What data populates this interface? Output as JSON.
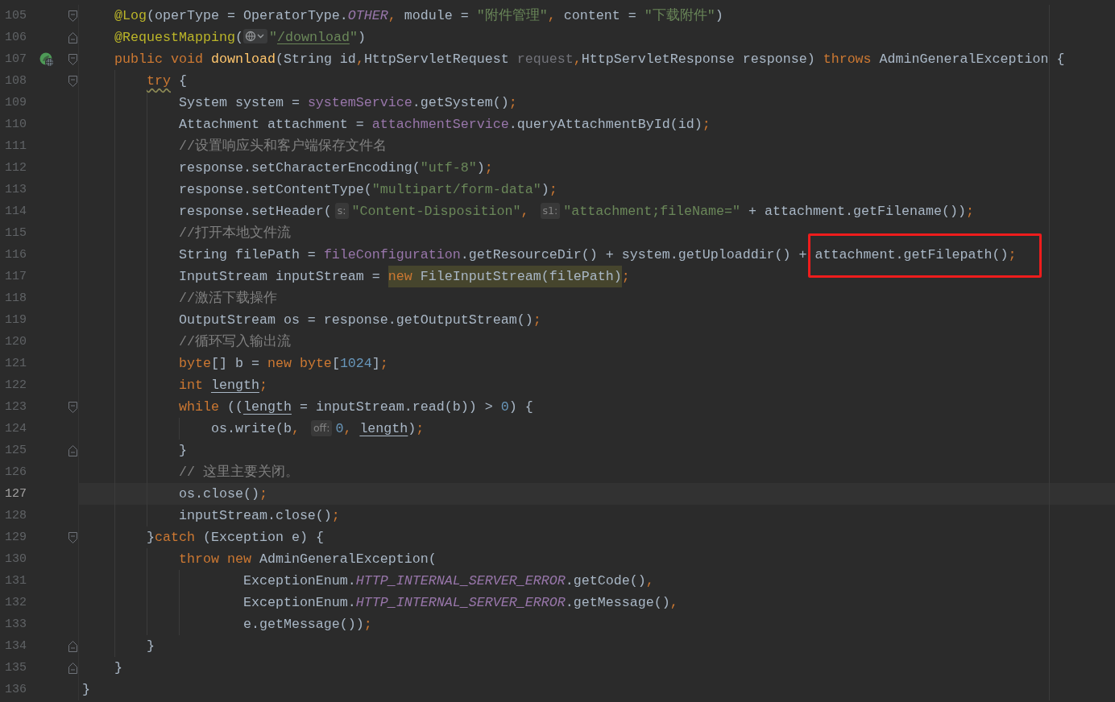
{
  "editor": {
    "lines": [
      {
        "number": "105",
        "fold_start": true,
        "fold_end": false,
        "endpoint": false,
        "current": false,
        "tokens": [
          {
            "kind": "annotation",
            "text": "    @Log"
          },
          {
            "kind": "plain",
            "text": "(operType = OperatorType."
          },
          {
            "kind": "constant",
            "text": "OTHER"
          },
          {
            "kind": "punct",
            "text": ","
          },
          {
            "kind": "plain",
            "text": " module = "
          },
          {
            "kind": "string",
            "text": "\"附件管理\""
          },
          {
            "kind": "punct",
            "text": ","
          },
          {
            "kind": "plain",
            "text": " content = "
          },
          {
            "kind": "string",
            "text": "\"下载附件\""
          },
          {
            "kind": "plain",
            "text": ")"
          }
        ]
      },
      {
        "number": "106",
        "fold_start": false,
        "fold_end": true,
        "endpoint": false,
        "current": false,
        "tokens": [
          {
            "kind": "annotation",
            "text": "    @RequestMapping"
          },
          {
            "kind": "plain",
            "text": "("
          },
          {
            "kind": "url-icon"
          },
          {
            "kind": "string",
            "text": "\""
          },
          {
            "kind": "link",
            "text": "/download"
          },
          {
            "kind": "string",
            "text": "\""
          },
          {
            "kind": "plain",
            "text": ")"
          }
        ]
      },
      {
        "number": "107",
        "fold_start": true,
        "fold_end": false,
        "endpoint": true,
        "current": false,
        "tokens": [
          {
            "kind": "keyword",
            "text": "    public void "
          },
          {
            "kind": "method",
            "text": "download"
          },
          {
            "kind": "plain",
            "text": "(String id"
          },
          {
            "kind": "punct",
            "text": ","
          },
          {
            "kind": "plain",
            "text": "HttpServletRequest "
          },
          {
            "kind": "unused",
            "text": "request"
          },
          {
            "kind": "punct",
            "text": ","
          },
          {
            "kind": "plain",
            "text": "HttpServletResponse response) "
          },
          {
            "kind": "keyword",
            "text": "throws "
          },
          {
            "kind": "plain",
            "text": "AdminGeneralException {"
          }
        ]
      },
      {
        "number": "108",
        "fold_start": true,
        "fold_end": false,
        "endpoint": false,
        "current": false,
        "tokens": [
          {
            "kind": "keyword-warning",
            "text": "        try"
          },
          {
            "kind": "plain",
            "text": " {"
          }
        ]
      },
      {
        "number": "109",
        "fold_start": false,
        "fold_end": false,
        "endpoint": false,
        "current": false,
        "tokens": [
          {
            "kind": "plain",
            "text": "            System system = "
          },
          {
            "kind": "field",
            "text": "systemService"
          },
          {
            "kind": "plain",
            "text": ".getSystem()"
          },
          {
            "kind": "punct",
            "text": ";"
          }
        ]
      },
      {
        "number": "110",
        "fold_start": false,
        "fold_end": false,
        "endpoint": false,
        "current": false,
        "tokens": [
          {
            "kind": "plain",
            "text": "            Attachment attachment = "
          },
          {
            "kind": "field",
            "text": "attachmentService"
          },
          {
            "kind": "plain",
            "text": ".queryAttachmentById(id)"
          },
          {
            "kind": "punct",
            "text": ";"
          }
        ]
      },
      {
        "number": "111",
        "fold_start": false,
        "fold_end": false,
        "endpoint": false,
        "current": false,
        "tokens": [
          {
            "kind": "comment",
            "text": "            //设置响应头和客户端保存文件名"
          }
        ]
      },
      {
        "number": "112",
        "fold_start": false,
        "fold_end": false,
        "endpoint": false,
        "current": false,
        "tokens": [
          {
            "kind": "plain",
            "text": "            response.setCharacterEncoding("
          },
          {
            "kind": "string",
            "text": "\"utf-8\""
          },
          {
            "kind": "plain",
            "text": ")"
          },
          {
            "kind": "punct",
            "text": ";"
          }
        ]
      },
      {
        "number": "113",
        "fold_start": false,
        "fold_end": false,
        "endpoint": false,
        "current": false,
        "tokens": [
          {
            "kind": "plain",
            "text": "            response.setContentType("
          },
          {
            "kind": "string",
            "text": "\"multipart/form-data\""
          },
          {
            "kind": "plain",
            "text": ")"
          },
          {
            "kind": "punct",
            "text": ";"
          }
        ]
      },
      {
        "number": "114",
        "fold_start": false,
        "fold_end": false,
        "endpoint": false,
        "current": false,
        "tokens": [
          {
            "kind": "plain",
            "text": "            response.setHeader("
          },
          {
            "kind": "hint",
            "text": "s:"
          },
          {
            "kind": "string",
            "text": "\"Content-Disposition\""
          },
          {
            "kind": "punct",
            "text": ", "
          },
          {
            "kind": "hint",
            "text": "s1:"
          },
          {
            "kind": "string",
            "text": "\"attachment;fileName=\""
          },
          {
            "kind": "plain",
            "text": " + attachment.getFilename())"
          },
          {
            "kind": "punct",
            "text": ";"
          }
        ]
      },
      {
        "number": "115",
        "fold_start": false,
        "fold_end": false,
        "endpoint": false,
        "current": false,
        "tokens": [
          {
            "kind": "comment",
            "text": "            //打开本地文件流"
          }
        ]
      },
      {
        "number": "116",
        "fold_start": false,
        "fold_end": false,
        "endpoint": false,
        "current": false,
        "tokens": [
          {
            "kind": "plain",
            "text": "            String filePath = "
          },
          {
            "kind": "field",
            "text": "fileConfiguration"
          },
          {
            "kind": "plain",
            "text": ".getResourceDir() + system.getUploaddir() + "
          },
          {
            "kind": "red-box",
            "tokens": [
              {
                "kind": "plain",
                "text": "attachment.getFilepath()"
              },
              {
                "kind": "punct",
                "text": ";"
              }
            ]
          }
        ]
      },
      {
        "number": "117",
        "fold_start": false,
        "fold_end": false,
        "endpoint": false,
        "current": false,
        "tokens": [
          {
            "kind": "plain",
            "text": "            InputStream inputStream = "
          },
          {
            "kind": "highlight",
            "tokens": [
              {
                "kind": "keyword",
                "text": "new "
              },
              {
                "kind": "plain",
                "text": "FileInputStream(filePath)"
              }
            ]
          },
          {
            "kind": "punct",
            "text": ";"
          }
        ]
      },
      {
        "number": "118",
        "fold_start": false,
        "fold_end": false,
        "endpoint": false,
        "current": false,
        "tokens": [
          {
            "kind": "comment",
            "text": "            //激活下载操作"
          }
        ]
      },
      {
        "number": "119",
        "fold_start": false,
        "fold_end": false,
        "endpoint": false,
        "current": false,
        "tokens": [
          {
            "kind": "plain",
            "text": "            OutputStream os = response.getOutputStream()"
          },
          {
            "kind": "punct",
            "text": ";"
          }
        ]
      },
      {
        "number": "120",
        "fold_start": false,
        "fold_end": false,
        "endpoint": false,
        "current": false,
        "tokens": [
          {
            "kind": "comment",
            "text": "            //循环写入输出流"
          }
        ]
      },
      {
        "number": "121",
        "fold_start": false,
        "fold_end": false,
        "endpoint": false,
        "current": false,
        "tokens": [
          {
            "kind": "keyword",
            "text": "            byte"
          },
          {
            "kind": "plain",
            "text": "[] b = "
          },
          {
            "kind": "keyword",
            "text": "new byte"
          },
          {
            "kind": "plain",
            "text": "["
          },
          {
            "kind": "number",
            "text": "1024"
          },
          {
            "kind": "plain",
            "text": "]"
          },
          {
            "kind": "punct",
            "text": ";"
          }
        ]
      },
      {
        "number": "122",
        "fold_start": false,
        "fold_end": false,
        "endpoint": false,
        "current": false,
        "tokens": [
          {
            "kind": "keyword",
            "text": "            int "
          },
          {
            "kind": "reassigned",
            "text": "length"
          },
          {
            "kind": "punct",
            "text": ";"
          }
        ]
      },
      {
        "number": "123",
        "fold_start": true,
        "fold_end": false,
        "endpoint": false,
        "current": false,
        "tokens": [
          {
            "kind": "keyword",
            "text": "            while "
          },
          {
            "kind": "plain",
            "text": "(("
          },
          {
            "kind": "reassigned",
            "text": "length"
          },
          {
            "kind": "plain",
            "text": " = inputStream.read(b)) > "
          },
          {
            "kind": "number",
            "text": "0"
          },
          {
            "kind": "plain",
            "text": ") {"
          }
        ]
      },
      {
        "number": "124",
        "fold_start": false,
        "fold_end": false,
        "endpoint": false,
        "current": false,
        "tokens": [
          {
            "kind": "plain",
            "text": "                os.write(b"
          },
          {
            "kind": "punct",
            "text": ", "
          },
          {
            "kind": "hint",
            "text": "off:"
          },
          {
            "kind": "number",
            "text": "0"
          },
          {
            "kind": "punct",
            "text": ", "
          },
          {
            "kind": "reassigned",
            "text": "length"
          },
          {
            "kind": "plain",
            "text": ")"
          },
          {
            "kind": "punct",
            "text": ";"
          }
        ]
      },
      {
        "number": "125",
        "fold_start": false,
        "fold_end": true,
        "endpoint": false,
        "current": false,
        "tokens": [
          {
            "kind": "plain",
            "text": "            }"
          }
        ]
      },
      {
        "number": "126",
        "fold_start": false,
        "fold_end": false,
        "endpoint": false,
        "current": false,
        "tokens": [
          {
            "kind": "comment",
            "text": "            // 这里主要关闭。"
          }
        ]
      },
      {
        "number": "127",
        "fold_start": false,
        "fold_end": false,
        "endpoint": false,
        "current": true,
        "tokens": [
          {
            "kind": "plain",
            "text": "            os.close()"
          },
          {
            "kind": "punct",
            "text": ";"
          }
        ]
      },
      {
        "number": "128",
        "fold_start": false,
        "fold_end": false,
        "endpoint": false,
        "current": false,
        "tokens": [
          {
            "kind": "plain",
            "text": "            inputStream.close()"
          },
          {
            "kind": "punct",
            "text": ";"
          }
        ]
      },
      {
        "number": "129",
        "fold_start": true,
        "fold_end": false,
        "endpoint": false,
        "current": false,
        "tokens": [
          {
            "kind": "plain",
            "text": "        }"
          },
          {
            "kind": "keyword",
            "text": "catch "
          },
          {
            "kind": "plain",
            "text": "(Exception e) {"
          }
        ]
      },
      {
        "number": "130",
        "fold_start": false,
        "fold_end": false,
        "endpoint": false,
        "current": false,
        "tokens": [
          {
            "kind": "keyword",
            "text": "            throw new "
          },
          {
            "kind": "plain",
            "text": "AdminGeneralException("
          }
        ]
      },
      {
        "number": "131",
        "fold_start": false,
        "fold_end": false,
        "endpoint": false,
        "current": false,
        "tokens": [
          {
            "kind": "plain",
            "text": "                    ExceptionEnum."
          },
          {
            "kind": "constant",
            "text": "HTTP_INTERNAL_SERVER_ERROR"
          },
          {
            "kind": "plain",
            "text": ".getCode()"
          },
          {
            "kind": "punct",
            "text": ","
          }
        ]
      },
      {
        "number": "132",
        "fold_start": false,
        "fold_end": false,
        "endpoint": false,
        "current": false,
        "tokens": [
          {
            "kind": "plain",
            "text": "                    ExceptionEnum."
          },
          {
            "kind": "constant",
            "text": "HTTP_INTERNAL_SERVER_ERROR"
          },
          {
            "kind": "plain",
            "text": ".getMessage()"
          },
          {
            "kind": "punct",
            "text": ","
          }
        ]
      },
      {
        "number": "133",
        "fold_start": false,
        "fold_end": false,
        "endpoint": false,
        "current": false,
        "tokens": [
          {
            "kind": "plain",
            "text": "                    e.getMessage())"
          },
          {
            "kind": "punct",
            "text": ";"
          }
        ]
      },
      {
        "number": "134",
        "fold_start": false,
        "fold_end": true,
        "endpoint": false,
        "current": false,
        "tokens": [
          {
            "kind": "plain",
            "text": "        }"
          }
        ]
      },
      {
        "number": "135",
        "fold_start": false,
        "fold_end": true,
        "endpoint": false,
        "current": false,
        "tokens": [
          {
            "kind": "plain",
            "text": "    }"
          }
        ]
      },
      {
        "number": "136",
        "fold_start": false,
        "fold_end": false,
        "endpoint": false,
        "current": false,
        "tokens": [
          {
            "kind": "plain",
            "text": "}"
          }
        ]
      }
    ]
  }
}
